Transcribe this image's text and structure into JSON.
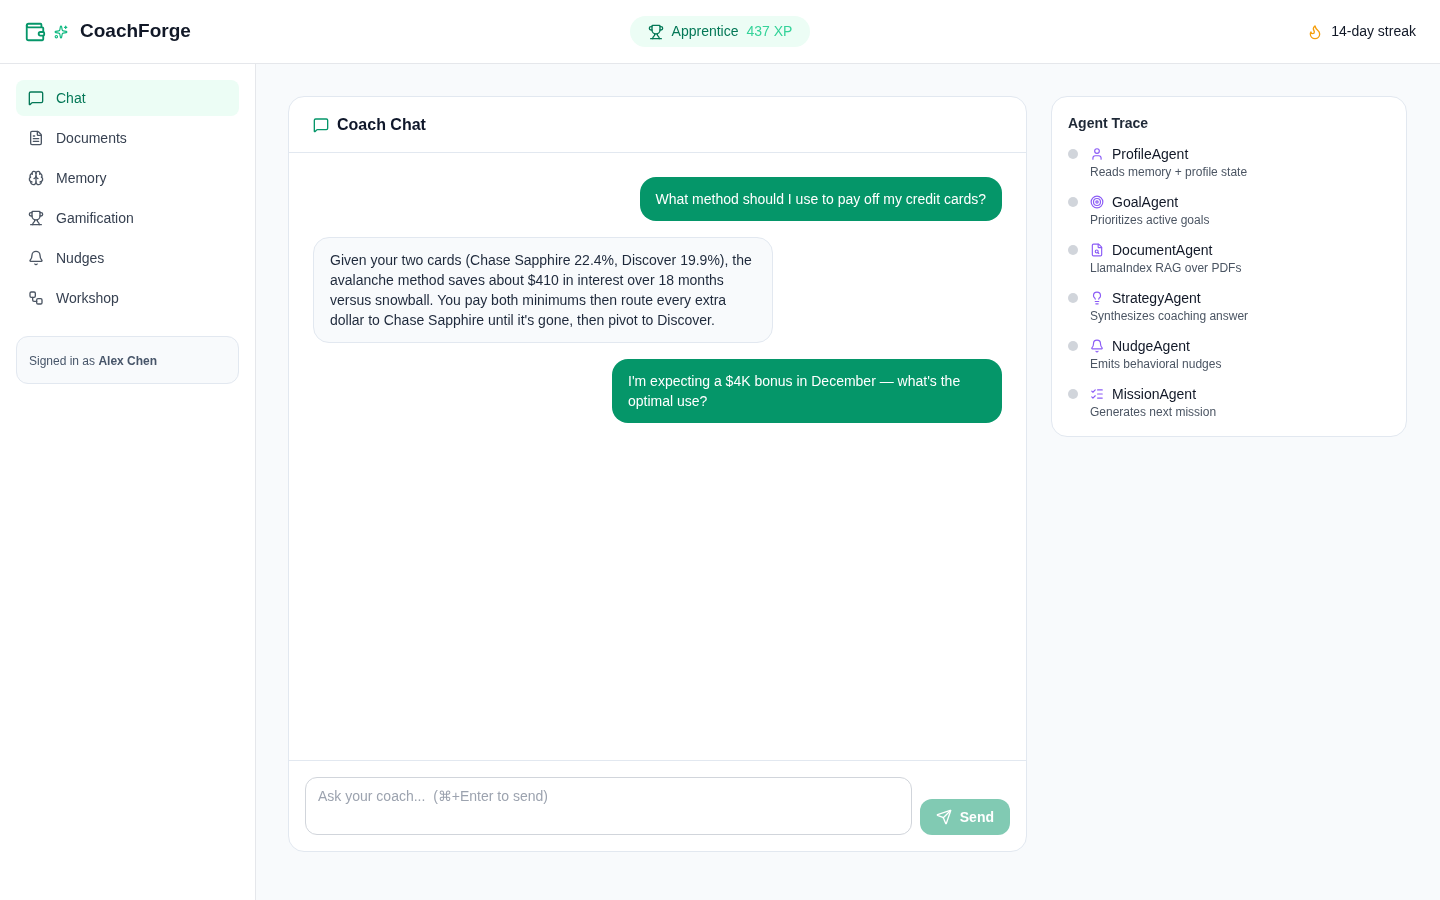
{
  "header": {
    "app_name": "CoachForge",
    "level_badge": {
      "title": "Apprentice",
      "xp": "437 XP"
    },
    "streak": "14-day streak"
  },
  "sidebar": {
    "items": [
      {
        "label": "Chat",
        "selected": true
      },
      {
        "label": "Documents",
        "selected": false
      },
      {
        "label": "Memory",
        "selected": false
      },
      {
        "label": "Gamification",
        "selected": false
      },
      {
        "label": "Nudges",
        "selected": false
      },
      {
        "label": "Workshop",
        "selected": false
      }
    ],
    "signed_in": "Signed in as **Alex Chen**"
  },
  "chat": {
    "title": "Coach Chat",
    "messages": [
      {
        "kind": "user",
        "text": "What method should I use to pay off my credit cards?"
      },
      {
        "kind": "coach",
        "text": "Given your two cards (Chase Sapphire 22.4%, Discover 19.9%), the avalanche method saves about $410 in interest over 18 months versus snowball. You pay both minimums then route every extra dollar to Chase Sapphire until it's gone, then pivot to Discover."
      },
      {
        "kind": "user",
        "text": "I'm expecting a $4K bonus in December — what's the optimal use?"
      }
    ],
    "composer": {
      "placeholder": "Ask your coach...  (⌘+Enter to send)",
      "send_label": "Send",
      "send_disabled": true
    }
  },
  "agent_trace": {
    "title": "Agent Trace",
    "agents": [
      {
        "name": "ProfileAgent",
        "description": "Reads memory + profile state",
        "active": false
      },
      {
        "name": "GoalAgent",
        "description": "Prioritizes active goals",
        "active": false
      },
      {
        "name": "DocumentAgent",
        "description": "LlamaIndex RAG over PDFs",
        "active": false
      },
      {
        "name": "StrategyAgent",
        "description": "Synthesizes coaching answer",
        "active": false
      },
      {
        "name": "NudgeAgent",
        "description": "Emits behavioral nudges",
        "active": false
      },
      {
        "name": "MissionAgent",
        "description": "Generates next mission",
        "active": false
      }
    ]
  }
}
